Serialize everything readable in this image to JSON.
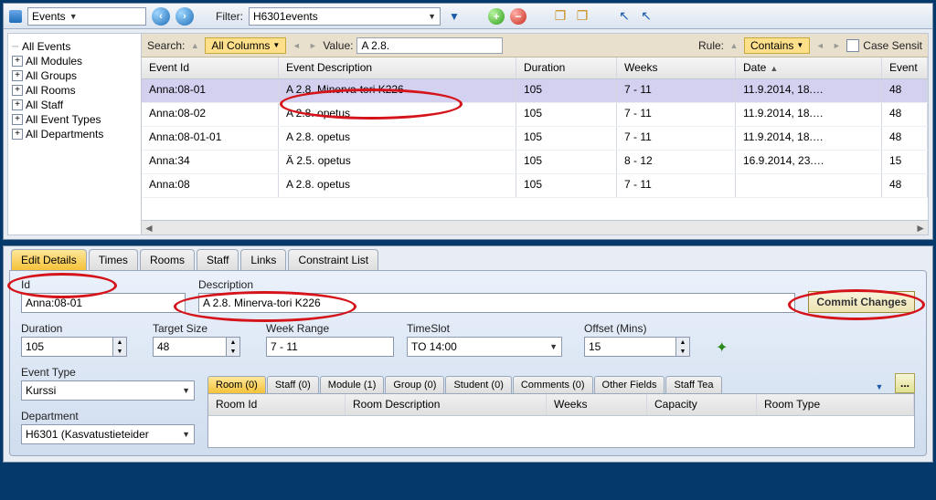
{
  "toolbar": {
    "entity_label": "Events",
    "filter_label": "Filter:",
    "filter_value": "H6301events"
  },
  "tree": {
    "items": [
      {
        "label": "All Events",
        "root": true
      },
      {
        "label": "All Modules"
      },
      {
        "label": "All Groups"
      },
      {
        "label": "All Rooms"
      },
      {
        "label": "All Staff"
      },
      {
        "label": "All Event Types"
      },
      {
        "label": "All Departments"
      }
    ]
  },
  "searchbar": {
    "search_label": "Search:",
    "columns_label": "All Columns",
    "value_label": "Value:",
    "value": "A 2.8.",
    "rule_label": "Rule:",
    "rule_value": "Contains",
    "case_label": "Case Sensit"
  },
  "grid": {
    "headers": {
      "id": "Event Id",
      "desc": "Event Description",
      "dur": "Duration",
      "wk": "Weeks",
      "date": "Date",
      "ev": "Event"
    },
    "rows": [
      {
        "id": "Anna:08-01",
        "desc": "A 2.8. Minerva-tori K226",
        "dur": "105",
        "wk": "7 - 11",
        "date": "11.9.2014, 18.…",
        "ev": "48",
        "sel": true
      },
      {
        "id": "Anna:08-02",
        "desc": "A 2.8. opetus",
        "dur": "105",
        "wk": "7 - 11",
        "date": "11.9.2014, 18.…",
        "ev": "48"
      },
      {
        "id": "Anna:08-01-01",
        "desc": "A 2.8. opetus",
        "dur": "105",
        "wk": "7 - 11",
        "date": "11.9.2014, 18.…",
        "ev": "48"
      },
      {
        "id": "Anna:34",
        "desc": "Ä 2.5. opetus",
        "dur": "105",
        "wk": "8 - 12",
        "date": "16.9.2014, 23.…",
        "ev": "15"
      },
      {
        "id": "Anna:08",
        "desc": "A 2.8. opetus",
        "dur": "105",
        "wk": "7 - 11",
        "date": "",
        "ev": "48"
      }
    ]
  },
  "detail_tabs": [
    "Edit Details",
    "Times",
    "Rooms",
    "Staff",
    "Links",
    "Constraint List"
  ],
  "details": {
    "id_label": "Id",
    "id_value": "Anna:08-01",
    "desc_label": "Description",
    "desc_value": "A 2.8. Minerva-tori K226",
    "commit_label": "Commit Changes",
    "duration_label": "Duration",
    "duration_value": "105",
    "target_label": "Target Size",
    "target_value": "48",
    "week_label": "Week Range",
    "week_value": "7 - 11",
    "slot_label": "TimeSlot",
    "slot_value": "TO 14:00",
    "offset_label": "Offset (Mins)",
    "offset_value": "15",
    "eventtype_label": "Event Type",
    "eventtype_value": "Kurssi",
    "dept_label": "Department",
    "dept_value": "H6301 (Kasvatustieteider"
  },
  "subtabs": [
    "Room (0)",
    "Staff (0)",
    "Module (1)",
    "Group (0)",
    "Student (0)",
    "Comments (0)",
    "Other Fields",
    "Staff Tea"
  ],
  "subgrid_headers": {
    "id": "Room Id",
    "desc": "Room Description",
    "wk": "Weeks",
    "cap": "Capacity",
    "type": "Room Type"
  },
  "more": "..."
}
